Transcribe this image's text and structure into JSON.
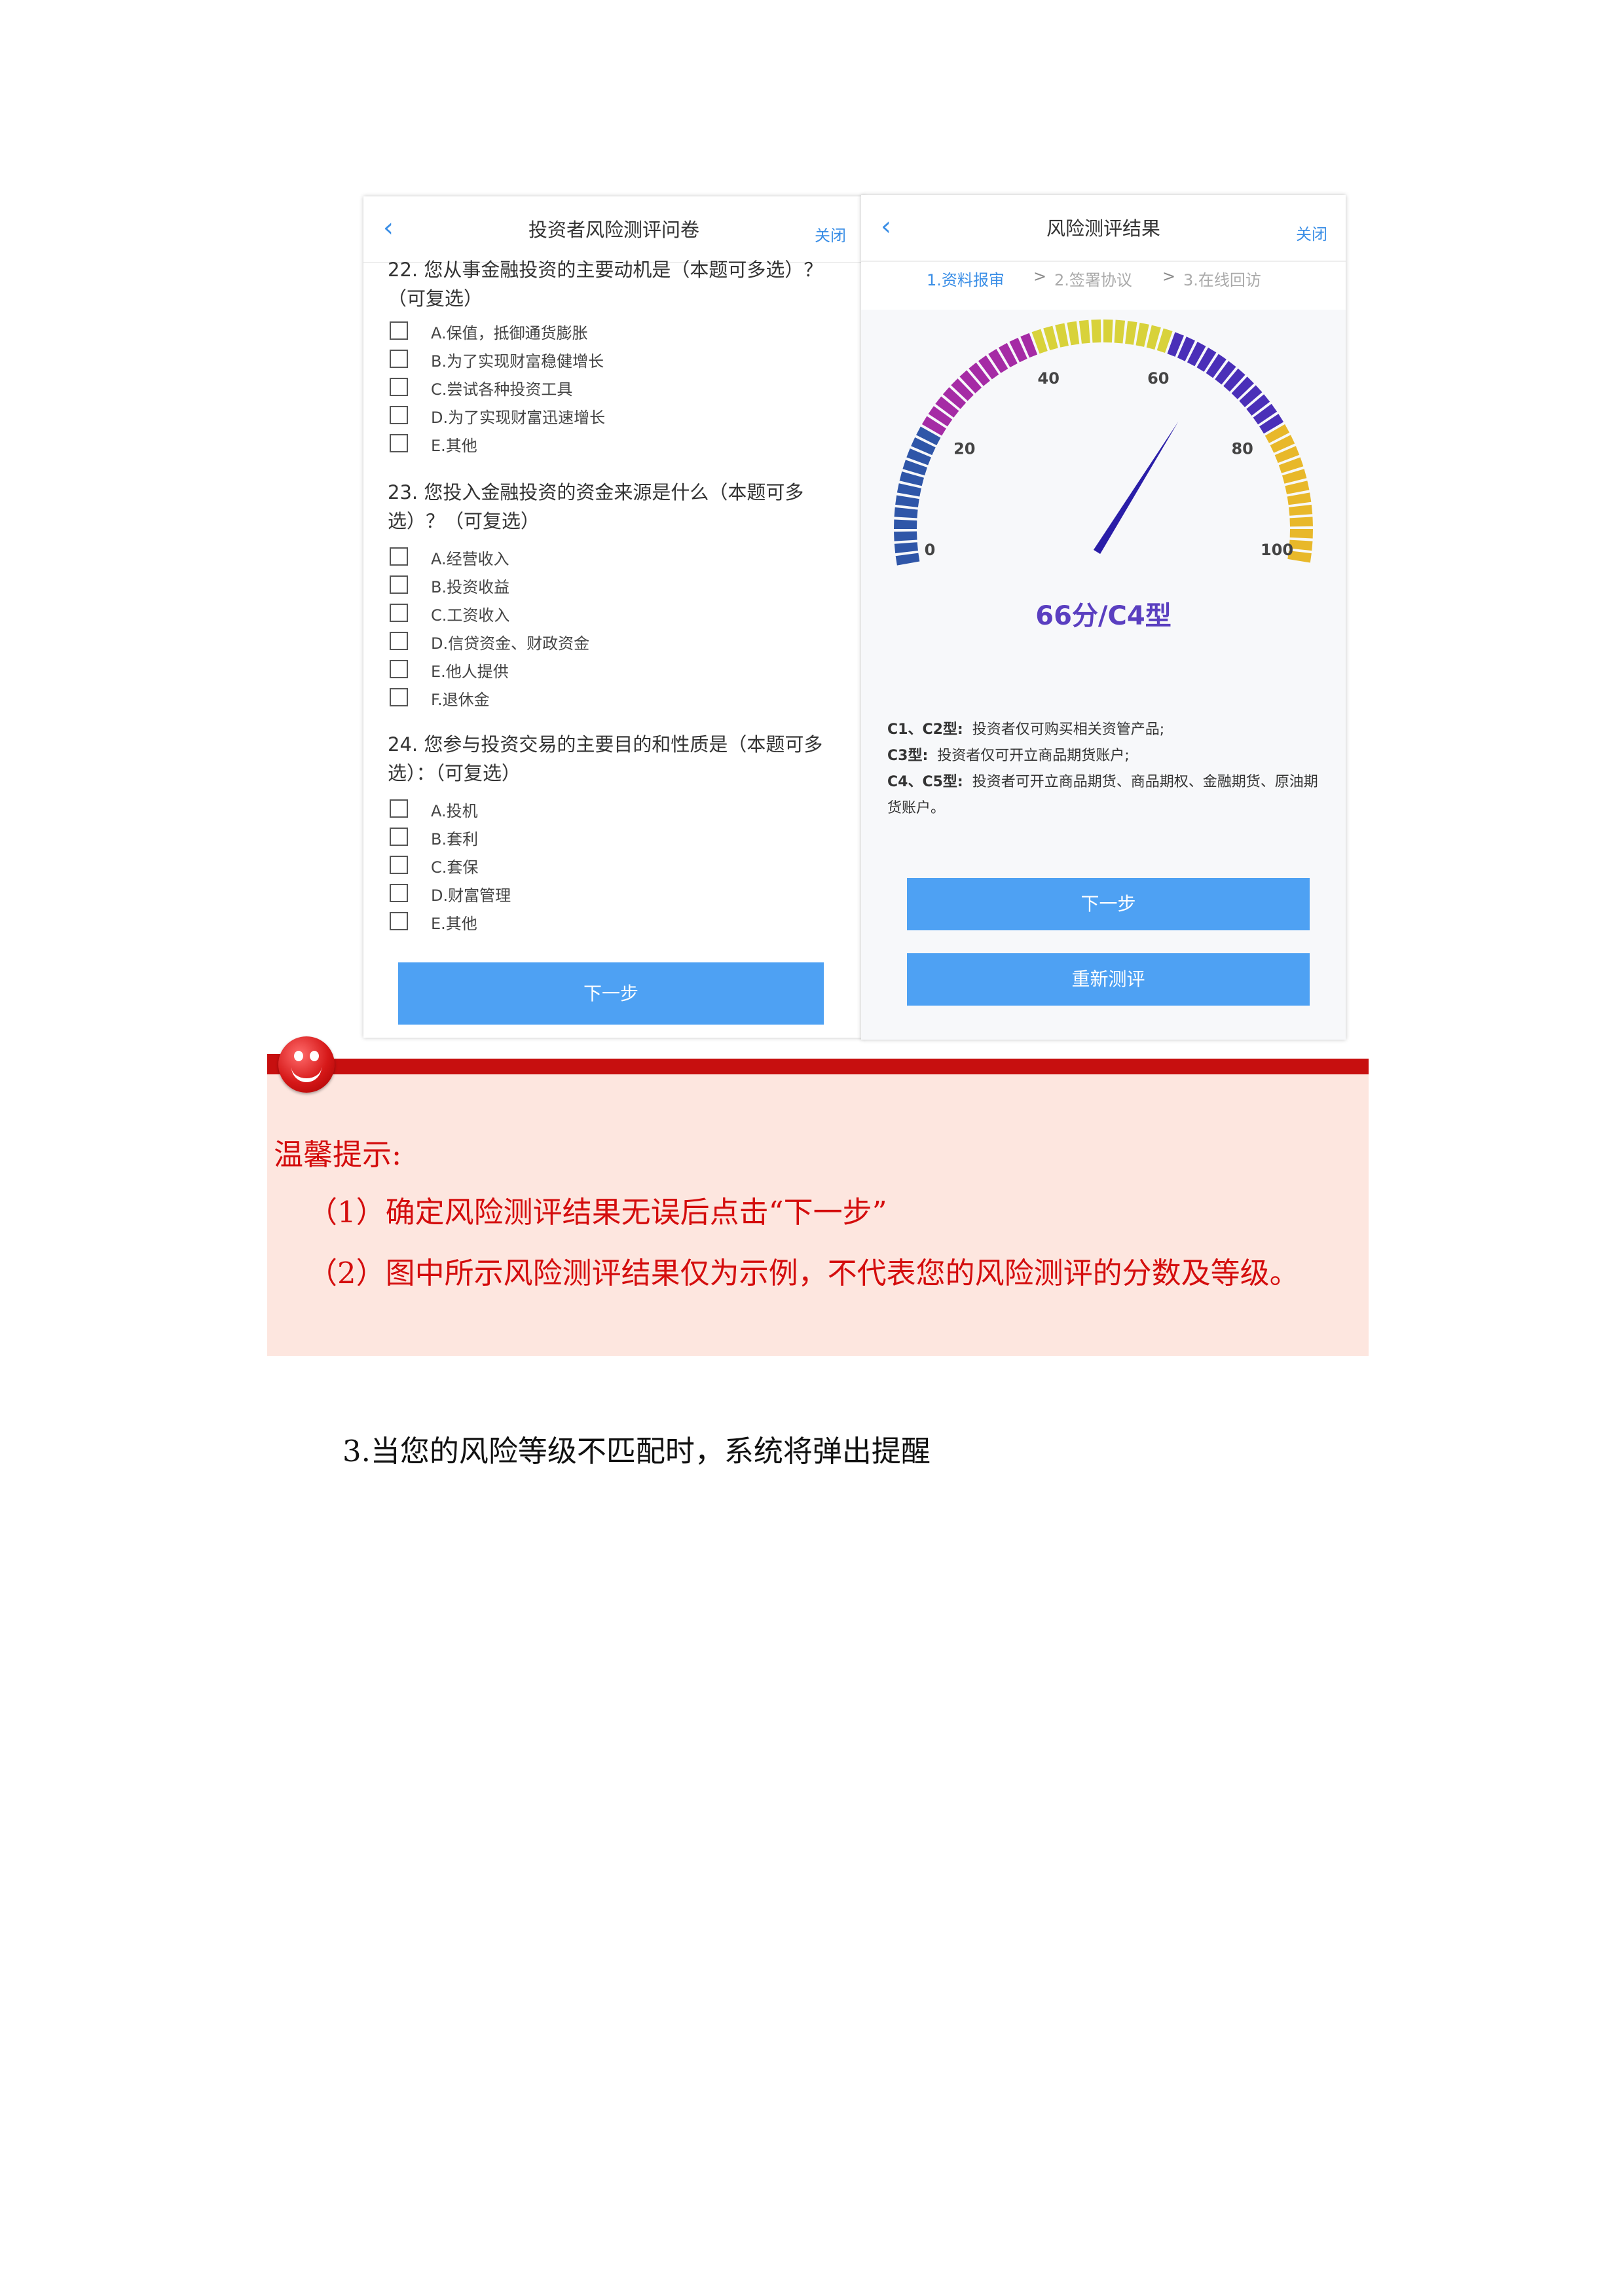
{
  "left_phone": {
    "back_icon": "chevron-left-icon",
    "title": "投资者风险测评问卷",
    "close_label": "关闭",
    "questions": [
      {
        "text": "22. 您从事金融投资的主要动机是（本题可多选）？（可复选）",
        "options": [
          "A.保值，抵御通货膨胀",
          "B.为了实现财富稳健增长",
          "C.尝试各种投资工具",
          "D.为了实现财富迅速增长",
          "E.其他"
        ]
      },
      {
        "text": "23. 您投入金融投资的资金来源是什么（本题可多选）？（可复选）",
        "options": [
          "A.经营收入",
          "B.投资收益",
          "C.工资收入",
          "D.信贷资金、财政资金",
          "E.他人提供",
          "F.退休金"
        ]
      },
      {
        "text": "24. 您参与投资交易的主要目的和性质是（本题可多选）：（可复选）",
        "options": [
          "A.投机",
          "B.套利",
          "C.套保",
          "D.财富管理",
          "E.其他"
        ]
      }
    ],
    "next_label": "下一步"
  },
  "right_phone": {
    "back_icon": "chevron-left-icon",
    "title": "风险测评结果",
    "close_label": "关闭",
    "steps": [
      "1.资料报审",
      "2.签署协议",
      "3.在线回访"
    ],
    "step_separator": ">",
    "gauge": {
      "ticks": [
        "0",
        "20",
        "40",
        "60",
        "80",
        "100"
      ],
      "min": 0,
      "max": 100,
      "value": 66,
      "colors": [
        "#2f56a8",
        "#a52ba5",
        "#d8d23a",
        "#4a2fb8",
        "#e8b82a"
      ],
      "needle_color": "#2a1ea8"
    },
    "score_text": "66分/C4型",
    "desc": [
      {
        "label": "C1、C2型:",
        "text": "投资者仅可购买相关资管产品;"
      },
      {
        "label": "C3型:",
        "text": "投资者仅可开立商品期货账户;"
      },
      {
        "label": "C4、C5型:",
        "text": "投资者可开立商品期货、商品期权、金融期货、原油期货账户。"
      }
    ],
    "next_label": "下一步",
    "retest_label": "重新测评"
  },
  "tip": {
    "icon": "smiley-icon",
    "heading": "温馨提示:",
    "line1": "（1）确定风险测评结果无误后点击“下一步”",
    "line2": "（2）图中所示风险测评结果仅为示例，不代表您的风险测评的分数及等级。"
  },
  "body": {
    "line": "3.当您的风险等级不匹配时，系统将弹出提醒"
  }
}
